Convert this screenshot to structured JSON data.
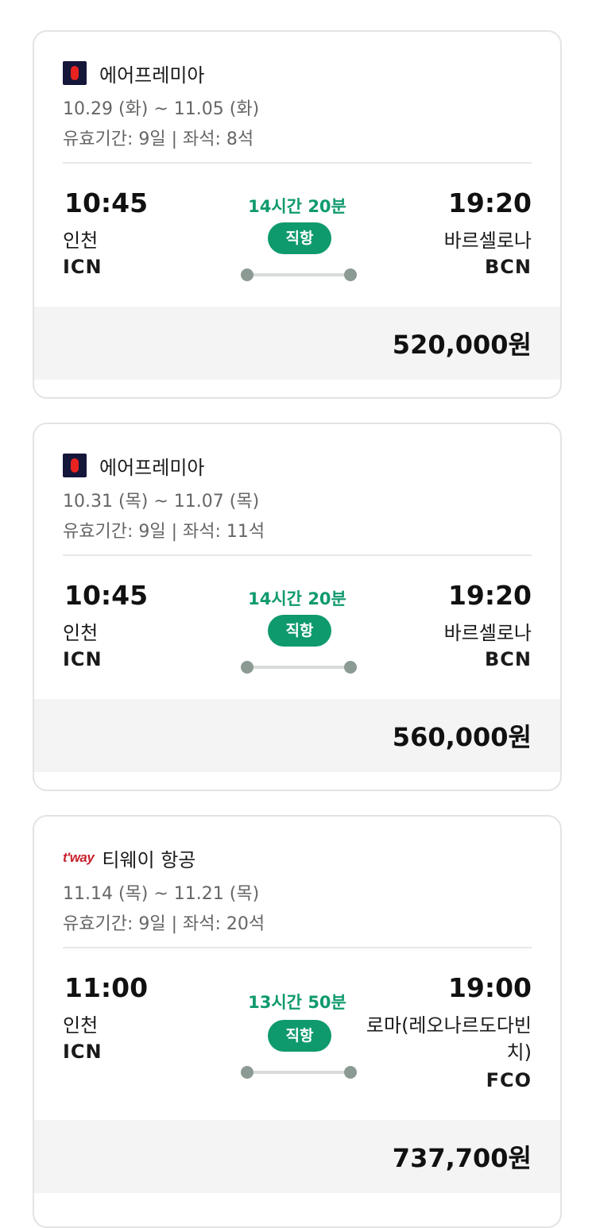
{
  "flights": [
    {
      "airline": "에어프레미아",
      "logo": "airpremia-logo",
      "dates": "10.29 (화) ~ 11.05 (화)",
      "meta": "유효기간: 9일 | 좌석: 8석",
      "dep_time": "10:45",
      "dep_city": "인천",
      "dep_code": "ICN",
      "duration": "14시간 20분",
      "stop_label": "직항",
      "arr_time": "19:20",
      "arr_city": "바르셀로나",
      "arr_code": "BCN",
      "price": "520,000원"
    },
    {
      "airline": "에어프레미아",
      "logo": "airpremia-logo",
      "dates": "10.31 (목) ~ 11.07 (목)",
      "meta": "유효기간: 9일 | 좌석: 11석",
      "dep_time": "10:45",
      "dep_city": "인천",
      "dep_code": "ICN",
      "duration": "14시간 20분",
      "stop_label": "직항",
      "arr_time": "19:20",
      "arr_city": "바르셀로나",
      "arr_code": "BCN",
      "price": "560,000원"
    },
    {
      "airline": "티웨이 항공",
      "logo": "tway-logo",
      "logo_text": "t'way",
      "dates": "11.14 (목) ~ 11.21 (목)",
      "meta": "유효기간: 9일 | 좌석: 20석",
      "dep_time": "11:00",
      "dep_city": "인천",
      "dep_code": "ICN",
      "duration": "13시간 50분",
      "stop_label": "직항",
      "arr_time": "19:00",
      "arr_city": "로마(레오나르도다빈치)",
      "arr_code": "FCO",
      "price": "737,700원"
    }
  ],
  "colors": {
    "accent": "#0f9a6e",
    "price_bar": "#f4f4f4",
    "airpremia_bg": "#14163a",
    "airpremia_mark": "#e8231f",
    "tway_red": "#c8232c"
  }
}
